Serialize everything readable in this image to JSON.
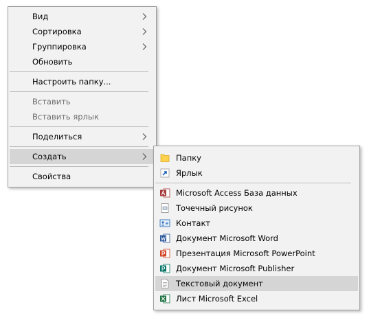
{
  "context_menu": {
    "items": [
      {
        "label": "Вид"
      },
      {
        "label": "Сортировка"
      },
      {
        "label": "Группировка"
      },
      {
        "label": "Обновить"
      },
      {
        "label": "Настроить папку..."
      },
      {
        "label": "Вставить"
      },
      {
        "label": "Вставить ярлык"
      },
      {
        "label": "Поделиться"
      },
      {
        "label": "Создать"
      },
      {
        "label": "Свойства"
      }
    ]
  },
  "submenu_create": {
    "items": [
      {
        "label": "Папку",
        "icon": "folder-icon"
      },
      {
        "label": "Ярлык",
        "icon": "shortcut-icon"
      },
      {
        "label": "Microsoft Access База данных",
        "icon": "access-icon"
      },
      {
        "label": "Точечный рисунок",
        "icon": "bitmap-icon"
      },
      {
        "label": "Контакт",
        "icon": "contact-icon"
      },
      {
        "label": "Документ Microsoft Word",
        "icon": "word-icon"
      },
      {
        "label": "Презентация Microsoft PowerPoint",
        "icon": "powerpoint-icon"
      },
      {
        "label": "Документ Microsoft Publisher",
        "icon": "publisher-icon"
      },
      {
        "label": "Текстовый документ",
        "icon": "text-document-icon"
      },
      {
        "label": "Лист Microsoft Excel",
        "icon": "excel-icon"
      }
    ]
  },
  "colors": {
    "menu_bg": "#f2f2f2",
    "highlight": "#d5d5d5",
    "disabled_text": "#6d6d6d",
    "word": "#2b579a",
    "excel": "#217346",
    "powerpoint": "#d24726",
    "access": "#a4373a",
    "publisher": "#077568"
  }
}
